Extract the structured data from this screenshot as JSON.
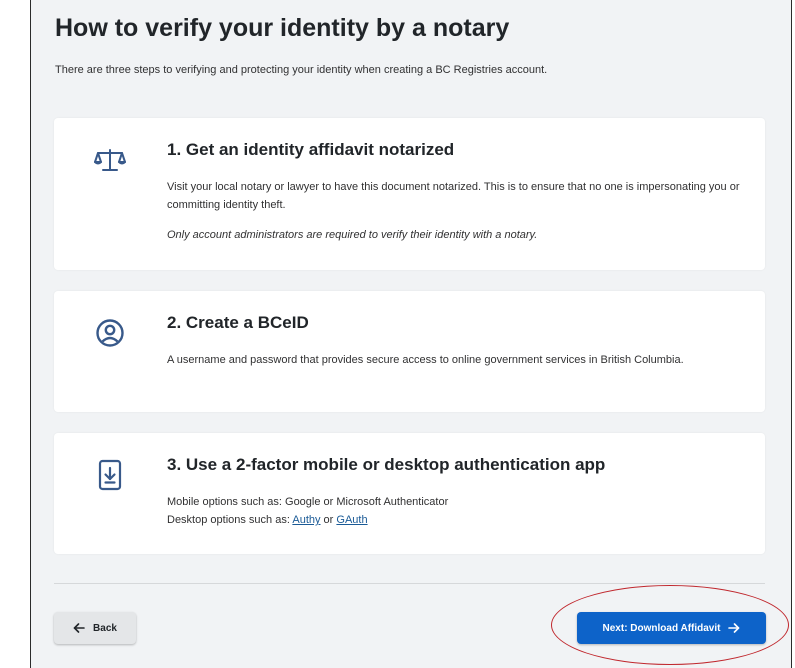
{
  "page": {
    "title": "How to verify your identity by a notary",
    "intro": "There are three steps to verifying and protecting your identity when creating a BC Registries account."
  },
  "steps": [
    {
      "icon": "scale-icon",
      "title": "1. Get an identity affidavit notarized",
      "body": "Visit your local notary or lawyer to have this document notarized. This is to ensure that no one is impersonating you or committing identity theft.",
      "note": "Only account administrators are required to verify their identity with a notary."
    },
    {
      "icon": "account-circle-icon",
      "title": "2. Create a BCeID",
      "body": "A username and password that provides secure access to online government services in British Columbia."
    },
    {
      "icon": "mobile-download-icon",
      "title": "3. Use a 2-factor mobile or desktop authentication app",
      "mobile_text": "Mobile options such as: Google or Microsoft Authenticator",
      "desktop_prefix": "Desktop options such as: ",
      "desktop_link_1": "Authy",
      "desktop_or": " or ",
      "desktop_link_2": "GAuth"
    }
  ],
  "actions": {
    "back_label": "Back",
    "back_icon": "arrow-left-icon",
    "next_label": "Next: Download Affidavit",
    "next_icon": "arrow-right-icon"
  },
  "colors": {
    "primary": "#0d63c9",
    "icon": "#38598a",
    "highlight": "#c0272d",
    "background": "#f1f3f5"
  }
}
